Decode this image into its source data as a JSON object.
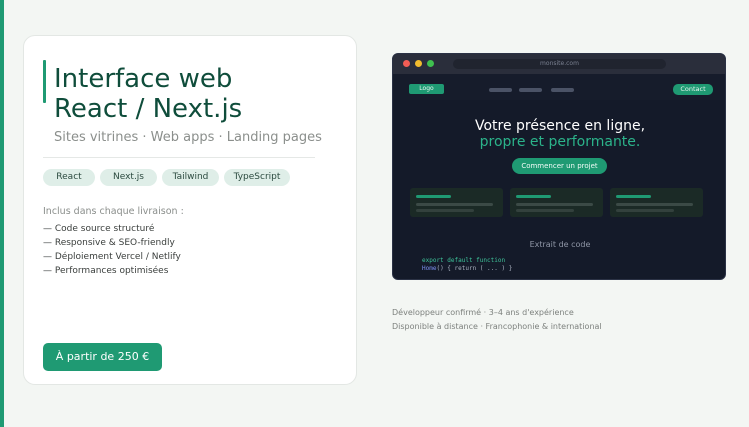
{
  "card": {
    "title_line1": "Interface web",
    "title_line2": "React / Next.js",
    "subtitle": "Sites vitrines · Web apps · Landing pages",
    "tags": [
      "React",
      "Next.js",
      "Tailwind",
      "TypeScript"
    ],
    "included_label": "Inclus dans chaque livraison :",
    "features": [
      "— Code source structuré",
      "— Responsive & SEO-friendly",
      "— Déploiement Vercel / Netlify",
      "— Performances optimisées"
    ],
    "price_button": "À partir de 250 €"
  },
  "mockup": {
    "url": "monsite.com",
    "logo": "Logo",
    "contact": "Contact",
    "hero_line1": "Votre présence en ligne,",
    "hero_line2": "propre et performante.",
    "cta": "Commencer un projet",
    "code_title": "Extrait de code",
    "code_line1": "export default function",
    "code_line2_kw": "Home",
    "code_line2_rest": "() { return ( ... ) }",
    "window_dots": [
      "#f25d55",
      "#f1bc2e",
      "#3fc04f"
    ]
  },
  "meta": {
    "line1": "Développeur confirmé · 3–4 ans d'expérience",
    "line2": "Disponible à distance · Francophonie & international"
  },
  "colors": {
    "accent": "#1f9a73",
    "title": "#0f4d3b",
    "mockup_bg": "#141a29"
  }
}
